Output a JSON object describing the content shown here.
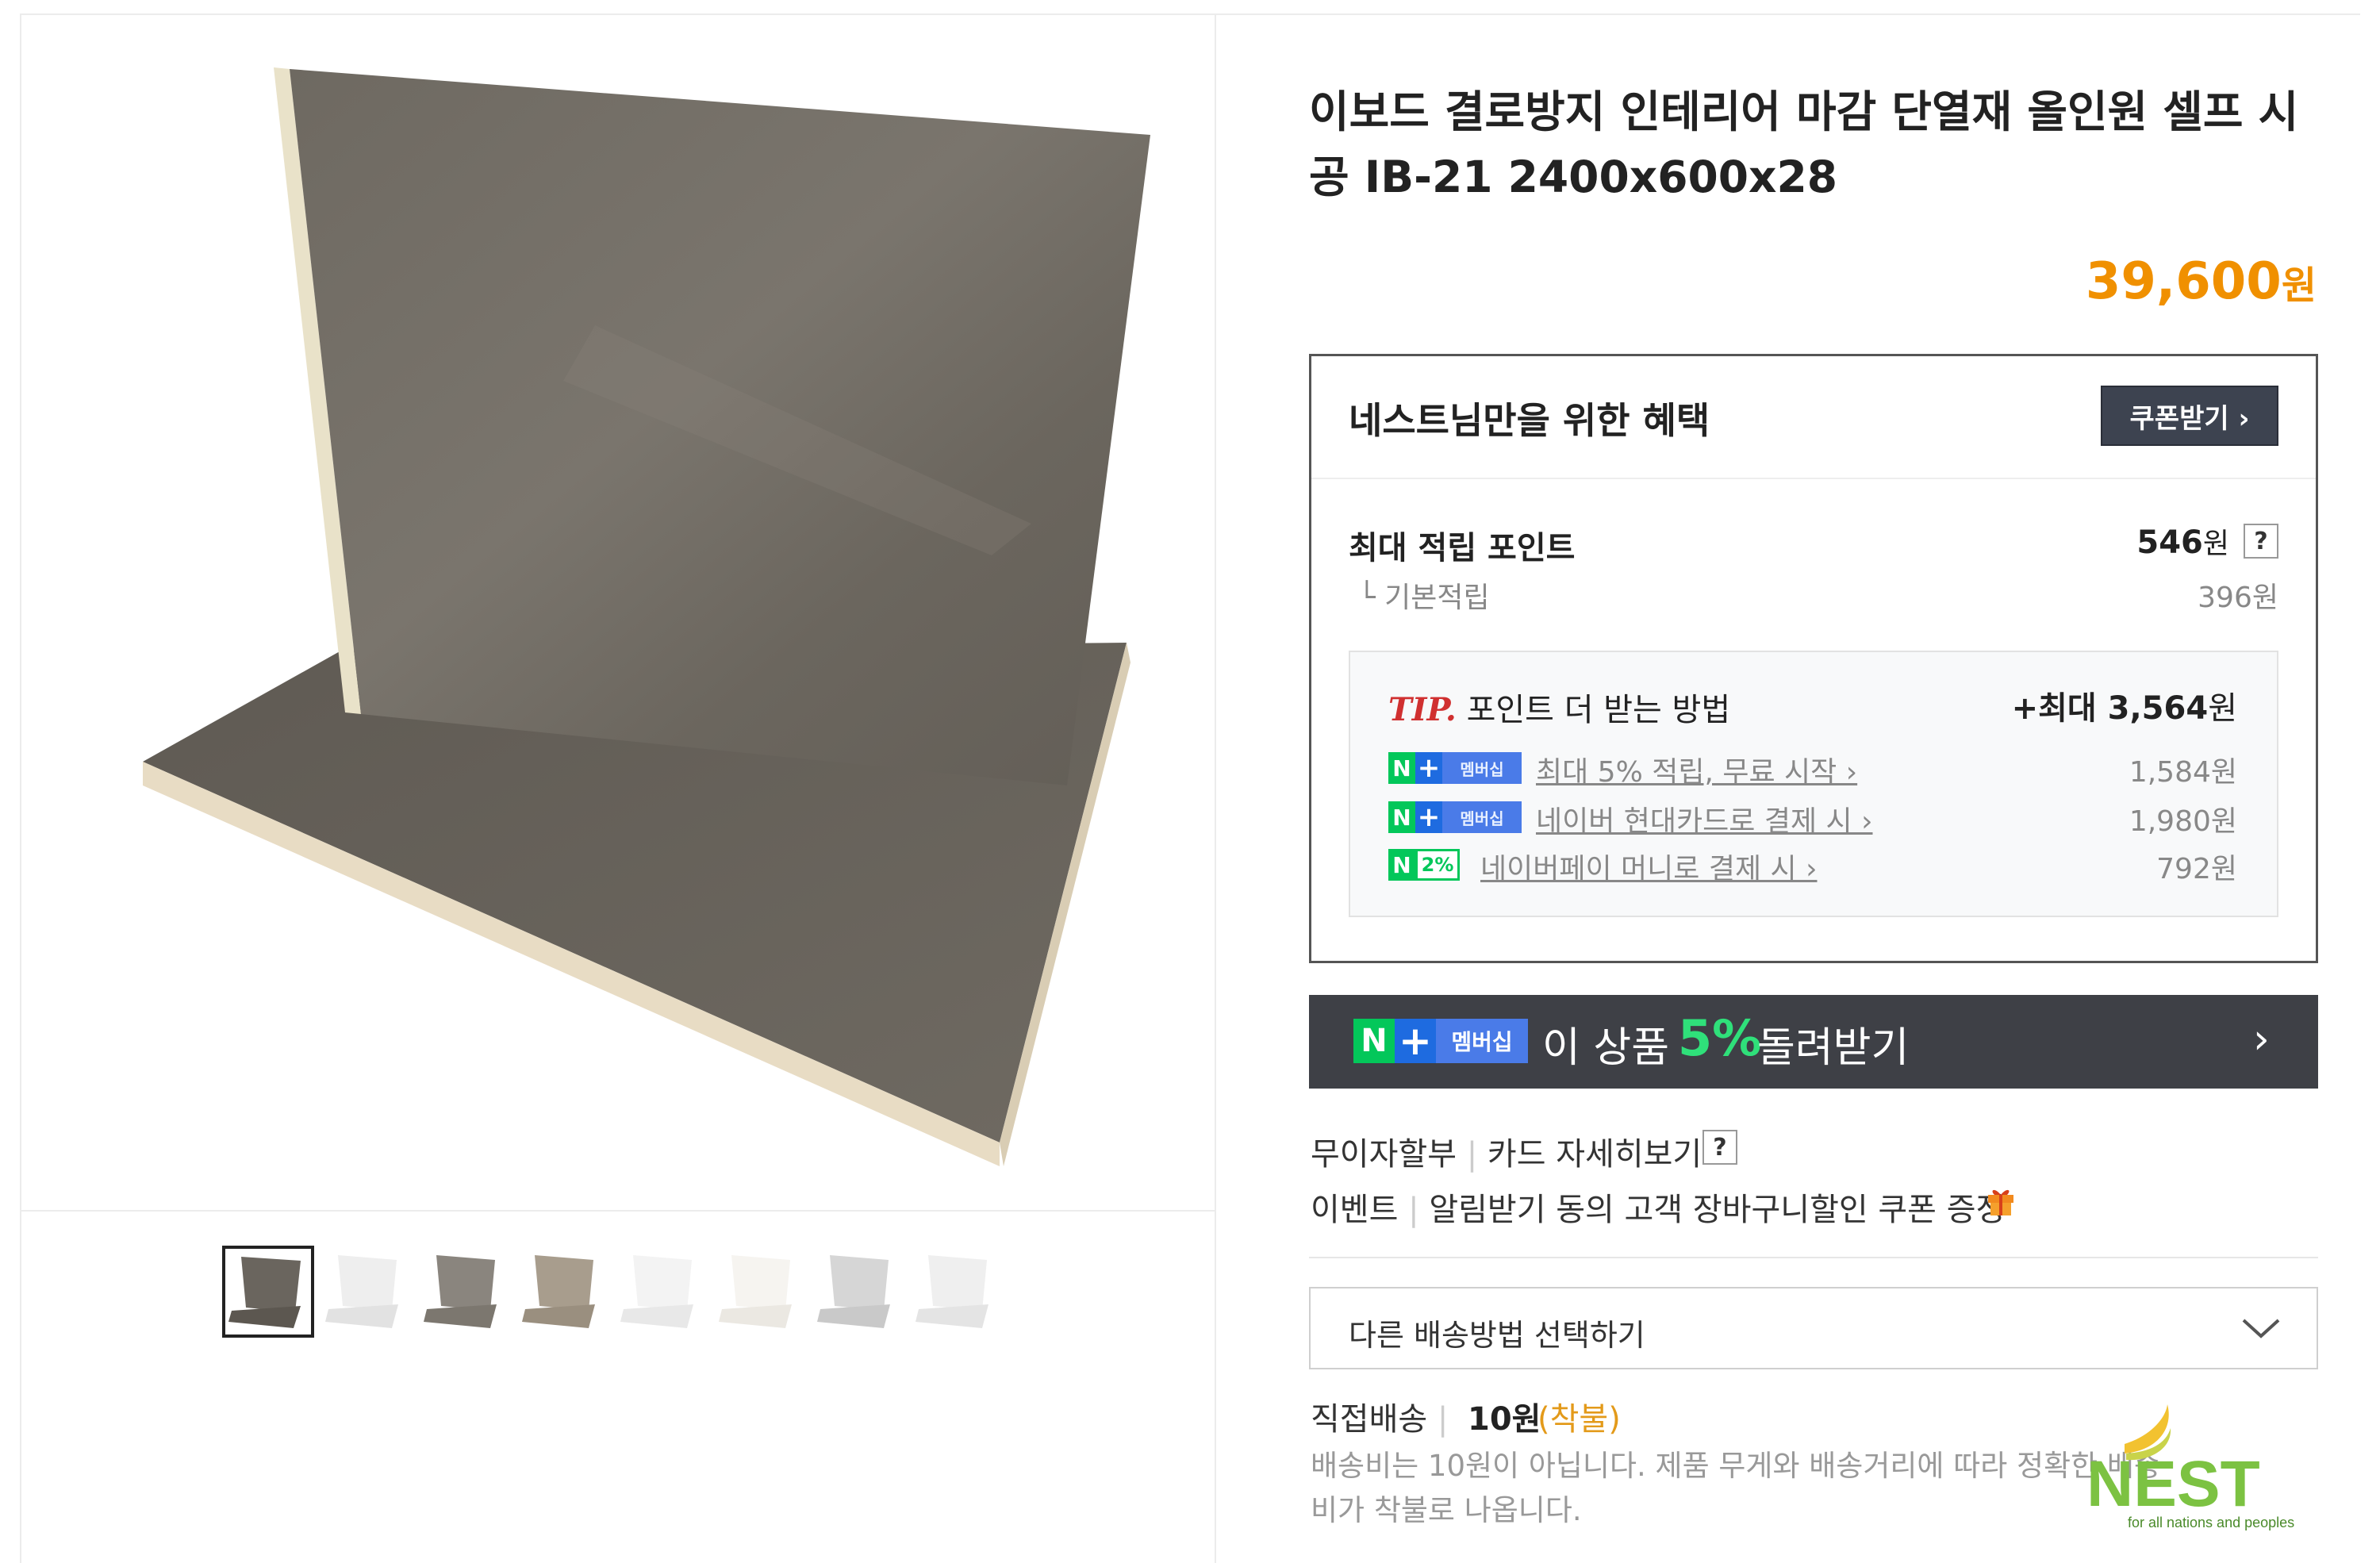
{
  "product": {
    "title": "이보드 결로방지 인테리어 마감 단열재 올인원 셀프 시공 IB-21 2400x600x28",
    "price": "39,600",
    "price_unit": "원"
  },
  "benefit": {
    "heading": "네스트님만을 위한 혜택",
    "coupon_label": "쿠폰받기 ›",
    "points_label": "최대 적립 포인트",
    "points_value": "546",
    "points_unit": "원",
    "help": "?",
    "base_label": "└ 기본적립",
    "base_value": "396원",
    "tip": {
      "mark": "TIP.",
      "title": " 포인트 더 받는 방법",
      "max_value": "+최대 3,564",
      "max_unit": "원",
      "rows": [
        {
          "badge_type": "membership",
          "badge_n": "N",
          "badge_plus": "+",
          "badge_tag": "멤버십",
          "link": "최대 5% 적립, 무료 시작 ›",
          "amount": "1,584원"
        },
        {
          "badge_type": "membership",
          "badge_n": "N",
          "badge_plus": "+",
          "badge_tag": "멤버십",
          "link": "네이버 현대카드로 결제 시 ›",
          "amount": "1,980원"
        },
        {
          "badge_type": "money",
          "badge_n": "N",
          "badge_pct": "2%",
          "link": "네이버페이 머니로 결제 시 ›",
          "amount": "792원"
        }
      ]
    }
  },
  "membership_banner": {
    "badge_n": "N",
    "badge_plus": "+",
    "badge_tag": "멤버십",
    "text_before": "이 상품",
    "percent": "5%",
    "text_after": "돌려받기",
    "arrow": "›"
  },
  "payment": {
    "installment": "무이자할부",
    "card_detail": "카드 자세히보기",
    "help": "?",
    "event_label": "이벤트",
    "event_text": "알림받기 동의 고객 장바구니할인 쿠폰 증정"
  },
  "shipping": {
    "select_label": "다른 배송방법 선택하기",
    "method": "직접배송",
    "fee": "10원",
    "fee_note": "(착불)",
    "note": "배송비는 10원이 아닙니다. 제품 무게와 배송거리에 따라 정확한 배송비가 착불로 나옵니다."
  },
  "logo": {
    "name": "NEST",
    "tagline": "for all nations and peoples"
  },
  "colors": {
    "price": "#f09000",
    "naver_green": "#03c75a",
    "membership_blue": "#1e6be0",
    "banner_bg": "#3e4046",
    "tip_red": "#d03030"
  },
  "gallery": {
    "thumbnails": [
      "gray-stone",
      "white",
      "gray",
      "beige",
      "white-gloss",
      "marble-white",
      "light-gray",
      "white-matte"
    ],
    "selected_index": 0
  }
}
